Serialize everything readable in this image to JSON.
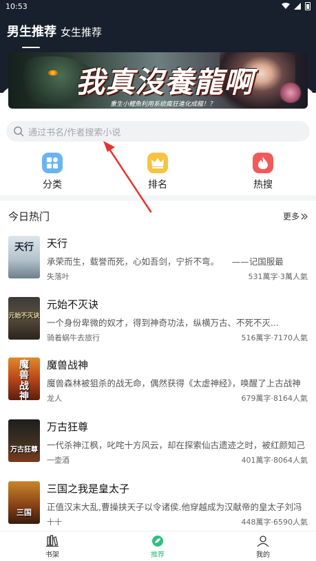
{
  "status_bar": {
    "time": "10:53"
  },
  "gender_tabs": {
    "active": "男生推荐",
    "other": "女生推荐"
  },
  "banner": {
    "title": "我真沒養龍啊",
    "subtitle": "重生小鯉魚利用系統瘋狂進化成龍！？"
  },
  "search": {
    "placeholder": "通过书名/作者搜索小说"
  },
  "categories": [
    {
      "label": "分类",
      "icon": "category-icon",
      "color": "#6ab4f2"
    },
    {
      "label": "排名",
      "icon": "crown-icon",
      "color": "#f7c343"
    },
    {
      "label": "热搜",
      "icon": "flame-icon",
      "color": "#f15a5a"
    }
  ],
  "hot": {
    "title": "今日热门",
    "more": "更多",
    "books": [
      {
        "title": "天行",
        "desc": "承荣而生，载誉而死，心如吾剑，宁折不弯。　　——记国服最",
        "author": "失落叶",
        "stats": "531萬字·3萬人氣",
        "cover_text": "天行"
      },
      {
        "title": "元始不灭诀",
        "desc": "一个身份卑微的奴才，得到神奇功法，纵横万古、不死不灭...",
        "author": "骑着蜗牛去旅行",
        "stats": "516萬字·7170人氣",
        "cover_text": "元始不灭诀"
      },
      {
        "title": "魔兽战神",
        "desc": "魔兽森林被狙杀的战无命，偶然获得《太虚神经》，唤醒了上古战神",
        "author": "龙人",
        "stats": "679萬字·8164人氣",
        "cover_text": "魔兽战神"
      },
      {
        "title": "万古狂尊",
        "desc": "一代杀神江枫，叱咤十方风云，却在探索仙古遗迹之时，被红颜知己",
        "author": "一壶酒",
        "stats": "401萬字·8064人氣",
        "cover_text": "万古狂尊"
      },
      {
        "title": "三国之我是皇太子",
        "desc": "正值汉末大乱,曹操挟天子以令诸侯.他穿越成为汉献帝的皇太子刘冯",
        "author": "十十",
        "stats": "448萬字·6590人氣",
        "cover_text": "三国"
      }
    ]
  },
  "bottom_nav": [
    {
      "label": "书架",
      "icon": "bookshelf-icon"
    },
    {
      "label": "推荐",
      "icon": "recommend-icon",
      "active": true
    },
    {
      "label": "我的",
      "icon": "profile-icon"
    }
  ],
  "colors": {
    "header_bg": "#17202c",
    "accent": "#2fbf7f",
    "arrow": "#e8332a"
  }
}
